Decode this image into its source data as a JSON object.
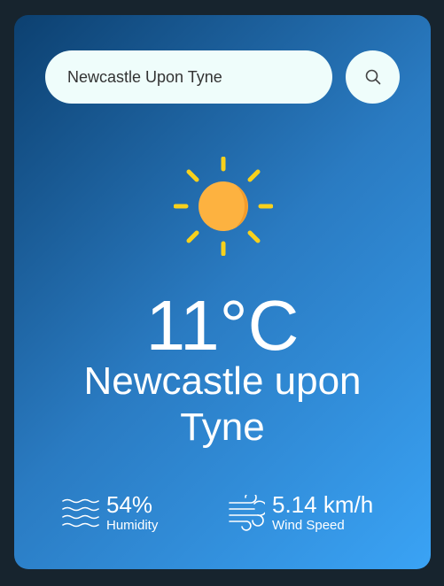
{
  "search": {
    "value": "Newcastle Upon Tyne",
    "icon": "search-icon"
  },
  "weather": {
    "icon": "sun-icon",
    "temperature": "11°C",
    "city": "Newcastle upon Tyne"
  },
  "details": {
    "humidity": {
      "icon": "humidity-waves-icon",
      "value": "54%",
      "label": "Humidity"
    },
    "wind": {
      "icon": "wind-icon",
      "value": "5.14 km/h",
      "label": "Wind Speed"
    }
  },
  "colors": {
    "page_background": "#17242e",
    "card_gradient_start": "#0c4070",
    "card_gradient_end": "#3aa3f5",
    "search_background": "#effdfb",
    "sun_body": "#fdb240",
    "sun_rays": "#f8d11c"
  }
}
